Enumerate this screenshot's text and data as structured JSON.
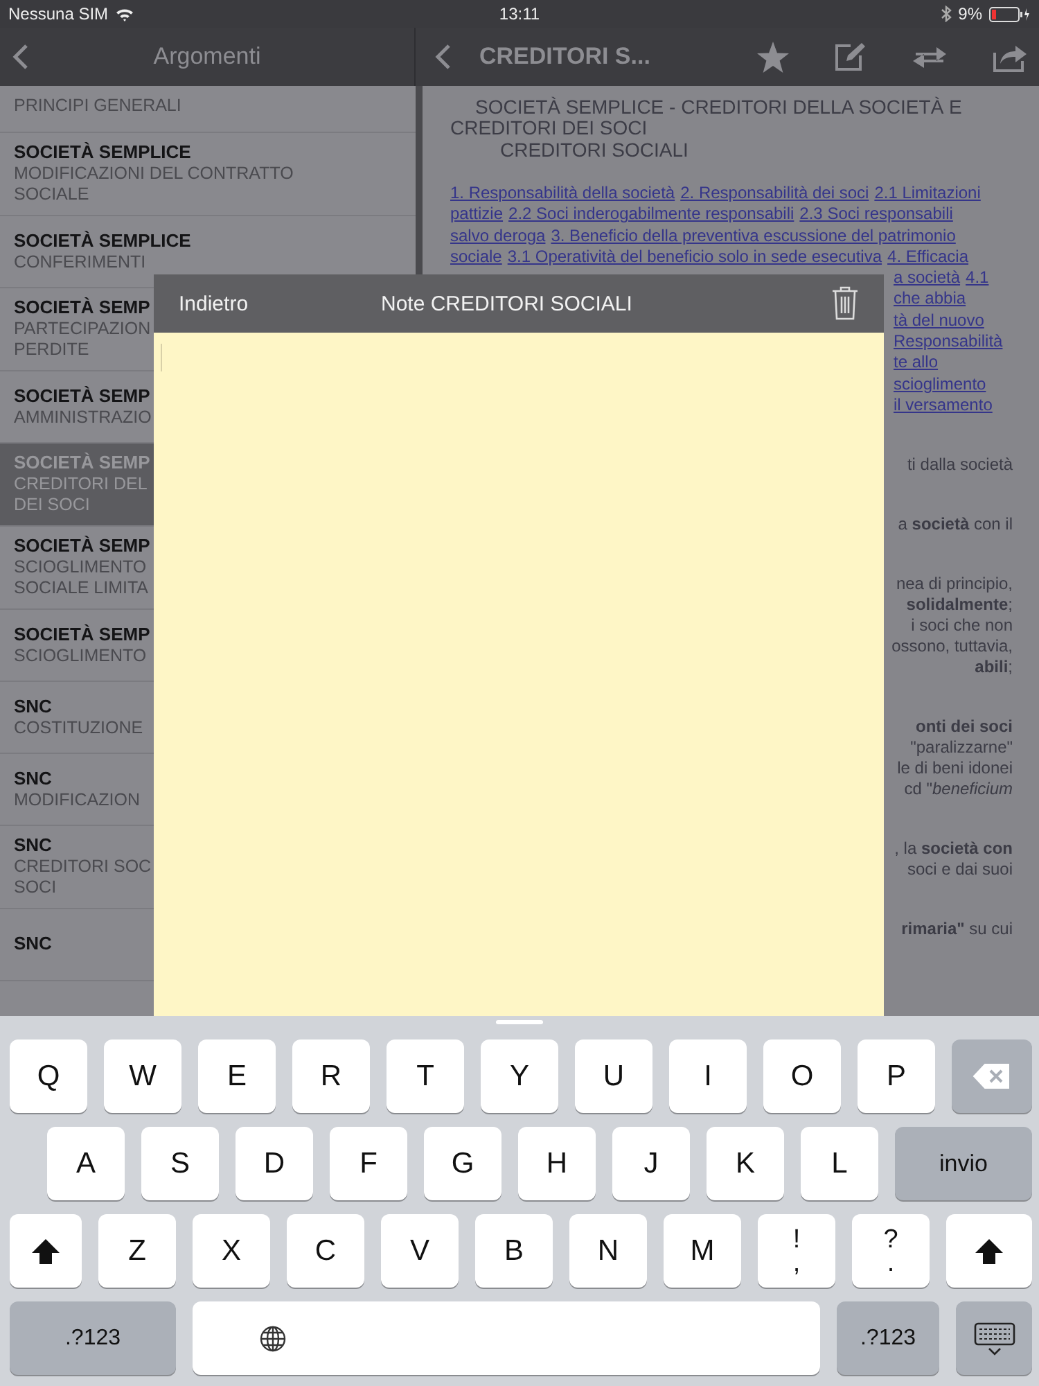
{
  "status_bar": {
    "carrier": "Nessuna SIM",
    "time": "13:11",
    "battery": "9%"
  },
  "left_nav": {
    "title": "Argomenti"
  },
  "right_nav": {
    "title": "CREDITORI S..."
  },
  "topics": [
    {
      "lines": [
        "PRINCIPI GENERALI"
      ],
      "selected": false
    },
    {
      "title": "SOCIETÀ SEMPLICE",
      "lines": [
        "MODIFICAZIONI DEL CONTRATTO",
        "SOCIALE"
      ],
      "selected": false
    },
    {
      "title": "SOCIETÀ SEMPLICE",
      "lines": [
        "CONFERIMENTI"
      ],
      "selected": false
    },
    {
      "title": "SOCIETÀ SEMP",
      "lines": [
        "PARTECIPAZION",
        "PERDITE"
      ],
      "selected": false
    },
    {
      "title": "SOCIETÀ SEMP",
      "lines": [
        "AMMINISTRAZIO"
      ],
      "selected": false
    },
    {
      "title": "SOCIETÀ SEMP",
      "lines": [
        "CREDITORI DEL",
        "DEI SOCI"
      ],
      "selected": true
    },
    {
      "title": "SOCIETÀ SEMP",
      "lines": [
        "SCIOGLIMENTO",
        "SOCIALE LIMITA"
      ],
      "selected": false
    },
    {
      "title": "SOCIETÀ SEMP",
      "lines": [
        "SCIOGLIMENTO"
      ],
      "selected": false
    },
    {
      "title": "SNC",
      "lines": [
        "COSTITUZIONE"
      ],
      "selected": false
    },
    {
      "title": "SNC",
      "lines": [
        "MODIFICAZION"
      ],
      "selected": false
    },
    {
      "title": "SNC",
      "lines": [
        "CREDITORI SOC",
        "SOCI"
      ],
      "selected": false
    },
    {
      "title": "SNC",
      "selected": false
    }
  ],
  "document": {
    "heading": "SOCIETÀ SEMPLICE - CREDITORI DELLA SOCIETÀ E CREDITORI DEI SOCI",
    "subheading": "CREDITORI SOCIALI",
    "link_lines": [
      [
        "1. Responsabilità della società",
        "2. Responsabilità dei soci",
        "2.1 Limitazioni"
      ],
      [
        "pattizie",
        "2.2 Soci inderogabilmente responsabili",
        "2.3 Soci responsabili"
      ],
      [
        "salvo deroga",
        "3. Beneficio della preventiva escussione del patrimonio"
      ],
      [
        "sociale",
        "3.1 Operatività del beneficio solo in sede esecutiva",
        "4. Efficacia"
      ]
    ],
    "link_fragments": [
      [
        "a società",
        "4.1"
      ],
      [
        "che abbia"
      ],
      [
        "tà del nuovo"
      ],
      [
        "Responsabilità"
      ],
      [
        "te allo"
      ],
      [
        "scioglimento"
      ],
      [
        "il versamento"
      ]
    ],
    "text_blocks": [
      [
        "ti dalla società"
      ],
      [
        "a **società** con il"
      ],
      [
        "nea di principio,",
        "**solidalmente**;",
        "i soci che non",
        "ossono, tuttavia,",
        "**abili**;"
      ],
      [
        "**onti dei soci**",
        "\"paralizzarne\"",
        "le di beni idonei",
        "cd \"*beneficium*"
      ],
      [
        ", la **società con**",
        "soci e dai suoi"
      ],
      [
        "**rimaria\"** su cui"
      ]
    ]
  },
  "note": {
    "back": "Indietro",
    "title": "Note CREDITORI SOCIALI"
  },
  "keyboard": {
    "rows": [
      {
        "keys": [
          {
            "kind": "letter",
            "label": "Q"
          },
          {
            "kind": "letter",
            "label": "W"
          },
          {
            "kind": "letter",
            "label": "E"
          },
          {
            "kind": "letter",
            "label": "R"
          },
          {
            "kind": "letter",
            "label": "T"
          },
          {
            "kind": "letter",
            "label": "Y"
          },
          {
            "kind": "letter",
            "label": "U"
          },
          {
            "kind": "letter",
            "label": "I"
          },
          {
            "kind": "letter",
            "label": "O"
          },
          {
            "kind": "letter",
            "label": "P"
          },
          {
            "kind": "backspace"
          }
        ]
      },
      {
        "keys": [
          {
            "kind": "letter",
            "label": "A"
          },
          {
            "kind": "letter",
            "label": "S"
          },
          {
            "kind": "letter",
            "label": "D"
          },
          {
            "kind": "letter",
            "label": "F"
          },
          {
            "kind": "letter",
            "label": "G"
          },
          {
            "kind": "letter",
            "label": "H"
          },
          {
            "kind": "letter",
            "label": "J"
          },
          {
            "kind": "letter",
            "label": "K"
          },
          {
            "kind": "letter",
            "label": "L"
          },
          {
            "kind": "enter",
            "label": "invio"
          }
        ]
      },
      {
        "keys": [
          {
            "kind": "shift"
          },
          {
            "kind": "letter",
            "label": "Z"
          },
          {
            "kind": "letter",
            "label": "X"
          },
          {
            "kind": "letter",
            "label": "C"
          },
          {
            "kind": "letter",
            "label": "V"
          },
          {
            "kind": "letter",
            "label": "B"
          },
          {
            "kind": "letter",
            "label": "N"
          },
          {
            "kind": "letter",
            "label": "M"
          },
          {
            "kind": "dual",
            "top": "!",
            "bottom": ","
          },
          {
            "kind": "dual",
            "top": "?",
            "bottom": "."
          },
          {
            "kind": "shift"
          }
        ]
      },
      {
        "keys": [
          {
            "kind": "mode",
            "label": ".?123"
          },
          {
            "kind": "space"
          },
          {
            "kind": "mode",
            "label": ".?123"
          },
          {
            "kind": "hide"
          }
        ]
      }
    ]
  }
}
